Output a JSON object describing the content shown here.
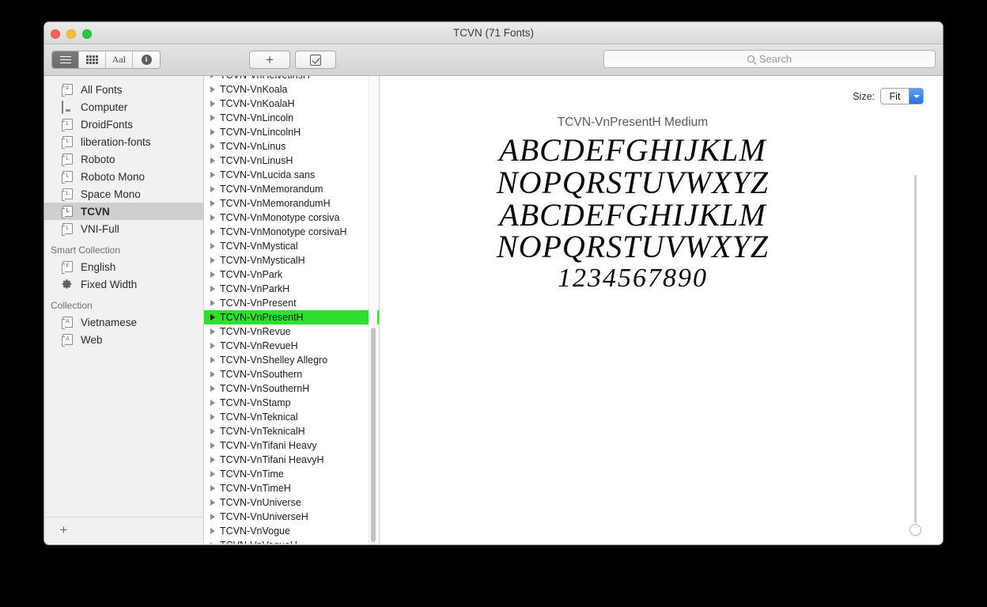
{
  "window": {
    "title": "TCVN (71 Fonts)",
    "traffic_lights": [
      "close",
      "minimize",
      "zoom"
    ]
  },
  "toolbar": {
    "view_segments": [
      {
        "name": "list-view",
        "icon": "list-icon",
        "active": true
      },
      {
        "name": "grid-view",
        "icon": "grid-icon",
        "active": false
      },
      {
        "name": "sample-view",
        "icon": "aa-icon",
        "label": "AaI",
        "active": false
      },
      {
        "name": "info-view",
        "icon": "info-icon",
        "label": "i",
        "active": false
      }
    ],
    "add_label": "+",
    "validate_icon": "checkbox-icon"
  },
  "search": {
    "placeholder": "Search",
    "value": "",
    "icon": "search-icon"
  },
  "sidebar": {
    "library_items": [
      {
        "label": "All Fonts",
        "icon": "font-library-icon",
        "glyph": "F",
        "selected": false
      },
      {
        "label": "Computer",
        "icon": "computer-icon",
        "glyph": "",
        "selected": false
      },
      {
        "label": "DroidFonts",
        "icon": "font-library-icon",
        "glyph": "L",
        "selected": false
      },
      {
        "label": "liberation-fonts",
        "icon": "font-library-icon",
        "glyph": "L",
        "selected": false
      },
      {
        "label": "Roboto",
        "icon": "font-library-icon",
        "glyph": "L",
        "selected": false
      },
      {
        "label": "Roboto Mono",
        "icon": "font-library-icon",
        "glyph": "L",
        "selected": false
      },
      {
        "label": "Space Mono",
        "icon": "font-library-icon",
        "glyph": "L",
        "selected": false
      },
      {
        "label": "TCVN",
        "icon": "font-library-icon",
        "glyph": "L",
        "selected": true
      },
      {
        "label": "VNI-Full",
        "icon": "font-library-icon",
        "glyph": "L",
        "selected": false
      }
    ],
    "smart_collection_header": "Smart Collection",
    "smart_collection_items": [
      {
        "label": "English",
        "icon": "font-library-icon",
        "glyph": "F"
      },
      {
        "label": "Fixed Width",
        "icon": "gear-icon",
        "glyph": ""
      }
    ],
    "collection_header": "Collection",
    "collection_items": [
      {
        "label": "Vietnamese",
        "icon": "collection-icon",
        "glyph": "A"
      },
      {
        "label": "Web",
        "icon": "collection-icon",
        "glyph": "A"
      }
    ],
    "new_collection_label": "+"
  },
  "font_list": {
    "selected": "TCVN-VnPresentH",
    "items": [
      {
        "label": "TCVN-VnHelvetinsH",
        "clipped": true
      },
      {
        "label": "TCVN-VnKoala"
      },
      {
        "label": "TCVN-VnKoalaH"
      },
      {
        "label": "TCVN-VnLincoln"
      },
      {
        "label": "TCVN-VnLincolnH"
      },
      {
        "label": "TCVN-VnLinus"
      },
      {
        "label": "TCVN-VnLinusH"
      },
      {
        "label": "TCVN-VnLucida sans"
      },
      {
        "label": "TCVN-VnMemorandum"
      },
      {
        "label": "TCVN-VnMemorandumH"
      },
      {
        "label": "TCVN-VnMonotype corsiva"
      },
      {
        "label": "TCVN-VnMonotype corsivaH"
      },
      {
        "label": "TCVN-VnMystical"
      },
      {
        "label": "TCVN-VnMysticalH"
      },
      {
        "label": "TCVN-VnPark"
      },
      {
        "label": "TCVN-VnParkH"
      },
      {
        "label": "TCVN-VnPresent"
      },
      {
        "label": "TCVN-VnPresentH"
      },
      {
        "label": "TCVN-VnRevue"
      },
      {
        "label": "TCVN-VnRevueH"
      },
      {
        "label": "TCVN-VnShelley Allegro"
      },
      {
        "label": "TCVN-VnSouthern"
      },
      {
        "label": "TCVN-VnSouthernH"
      },
      {
        "label": "TCVN-VnStamp"
      },
      {
        "label": "TCVN-VnTeknical"
      },
      {
        "label": "TCVN-VnTeknicalH"
      },
      {
        "label": "TCVN-VnTifani Heavy"
      },
      {
        "label": "TCVN-VnTifani HeavyH"
      },
      {
        "label": "TCVN-VnTime"
      },
      {
        "label": "TCVN-VnTimeH"
      },
      {
        "label": "TCVN-VnUniverse"
      },
      {
        "label": "TCVN-VnUniverseH"
      },
      {
        "label": "TCVN-VnVogue"
      },
      {
        "label": "TCVN-VnVogueH"
      }
    ]
  },
  "preview": {
    "size_label": "Size:",
    "size_value": "Fit",
    "specimen_name": "TCVN-VnPresentH Medium",
    "lines": [
      "ABCDEFGHIJKLM",
      "NOPQRSTUVWXYZ",
      "ABCDEFGHIJKLM",
      "NOPQRSTUVWXYZ"
    ],
    "digits": "1234567890"
  },
  "colors": {
    "selection_green": "#2ee02e",
    "sidebar_selection": "#cfcfcf",
    "slider_blue": "#2a5bf5",
    "window_chrome": "#e4e4e4"
  }
}
